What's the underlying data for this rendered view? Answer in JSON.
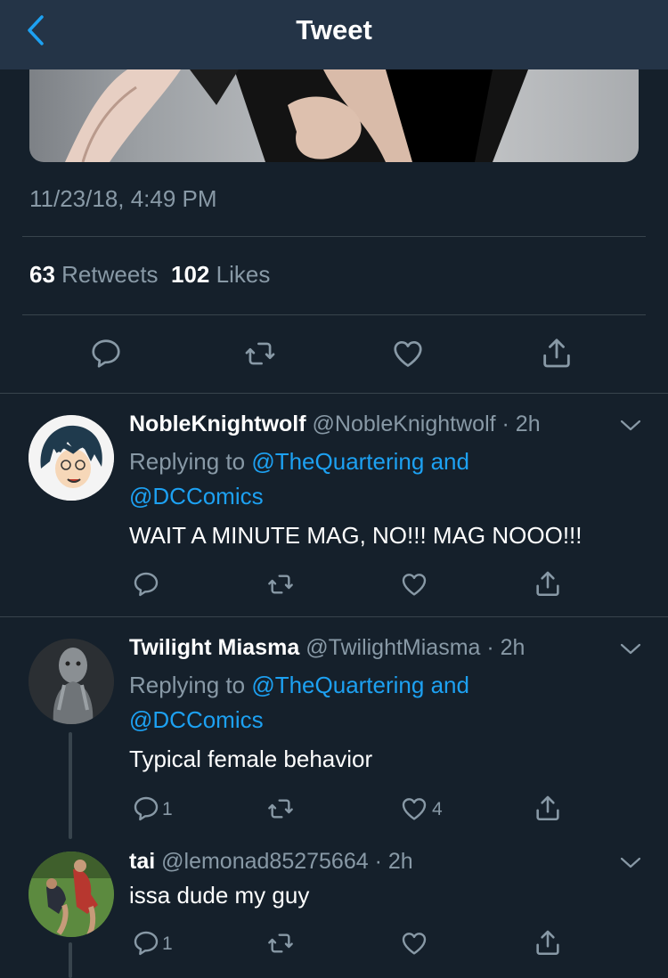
{
  "header": {
    "title": "Tweet",
    "back_icon": "chevron-left-icon"
  },
  "main_tweet": {
    "timestamp": "11/23/18, 4:49 PM",
    "retweets_count": "63",
    "retweets_label": "Retweets",
    "likes_count": "102",
    "likes_label": "Likes"
  },
  "replies": [
    {
      "name": "NobleKnightwolf",
      "handle": "@NobleKnightwolf · 2h",
      "replying_prefix": "Replying to",
      "mention1": "@TheQuartering and",
      "mention2": "@DCComics",
      "text": "WAIT A MINUTE MAG, NO!!! MAG NOOO!!!",
      "reply_count": "",
      "like_count": ""
    },
    {
      "name": "Twilight Miasma",
      "handle": "@TwilightMiasma · 2h",
      "replying_prefix": "Replying to",
      "mention1": "@TheQuartering and",
      "mention2": "@DCComics",
      "text": "Typical female behavior",
      "reply_count": "1",
      "like_count": "4"
    },
    {
      "name": "tai",
      "handle": "@lemonad85275664 · 2h",
      "text": "issa dude my guy",
      "reply_count": "1",
      "like_count": ""
    }
  ],
  "colors": {
    "background": "#15202b",
    "header": "#243447",
    "link": "#1da1f2",
    "muted": "#8899a6",
    "divider": "#38444d"
  }
}
